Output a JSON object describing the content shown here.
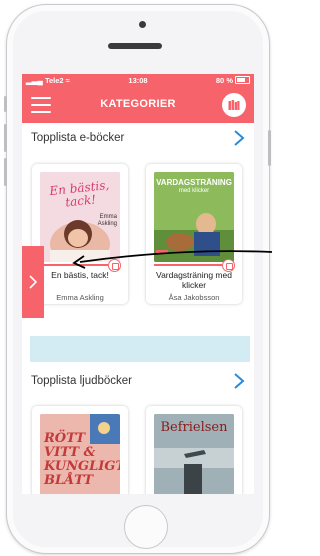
{
  "status_bar": {
    "carrier": "Tele2",
    "time": "13:08",
    "battery": "80 %"
  },
  "header": {
    "title": "KATEGORIER",
    "menu_icon": "hamburger-icon",
    "library_icon": "bookshelf-icon"
  },
  "sections": [
    {
      "title": "Topplista e-böcker",
      "items": [
        {
          "title": "En bästis, tack!",
          "author": "Emma Askling",
          "cover_text": {
            "title": "En bästis, tack!",
            "author": "Emma Askling"
          },
          "cover_color": "#f2d6dd"
        },
        {
          "title": "Vardagsträning med klicker",
          "author": "Åsa Jakobsson",
          "cover_text": {
            "title": "VARDAGSTRÄNING",
            "subtitle": "med klicker"
          },
          "cover_color": "#7ab24e"
        }
      ]
    },
    {
      "title": "Topplista ljudböcker",
      "items": [
        {
          "cover_text": {
            "title": "RÖTT VITT & KUNGLIGT BLÅTT"
          },
          "cover_color": "#e9b0a6"
        },
        {
          "cover_text": {
            "title": "Befrielsen"
          },
          "cover_color": "#8fa3ab"
        }
      ]
    }
  ],
  "colors": {
    "accent": "#f6636a",
    "banner": "#d3ecf4",
    "chevron": "#2b8ad8"
  }
}
